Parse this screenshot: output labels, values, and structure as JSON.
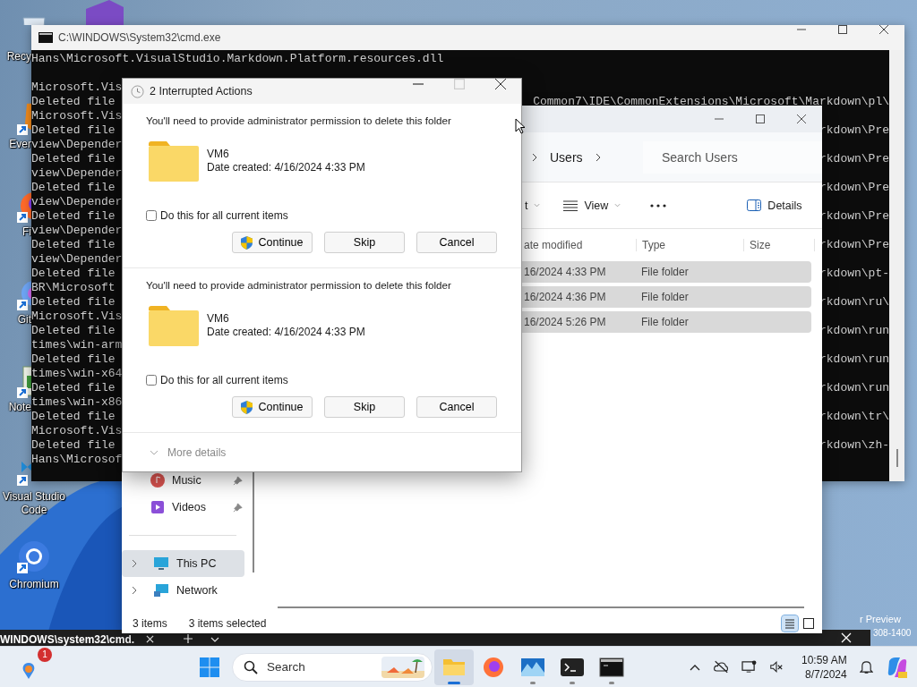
{
  "desktop": {
    "icons": [
      {
        "label": "Recy",
        "kind": "recycle-bin",
        "shortcut": false
      },
      {
        "label": "Ever",
        "kind": "evernote",
        "shortcut": true
      },
      {
        "label": "Fi",
        "kind": "firefox",
        "shortcut": true
      },
      {
        "label": "Git",
        "kind": "github",
        "shortcut": true
      },
      {
        "label": "Note",
        "kind": "notepad",
        "shortcut": true
      },
      {
        "label": "Visual Studio Code",
        "kind": "vscode",
        "shortcut": true
      },
      {
        "label": "Chromium",
        "kind": "chromium",
        "shortcut": true
      }
    ],
    "build_info": [
      "r Preview",
      "308-1400"
    ]
  },
  "cmd_window": {
    "title": "C:\\WINDOWS\\System32\\cmd.exe",
    "first_line": "Hans\\Microsoft.VisualStudio.Markdown.Platform.resources.dll",
    "lines": [
      {
        "left": "Microsoft.Vis"
      },
      {
        "left": "Deleted file",
        "right": "Common7\\IDE\\CommonExtensions\\Microsoft\\Markdown\\pl\\"
      },
      {
        "left": "Microsoft.Vis"
      },
      {
        "left": "Deleted file",
        "right": "rkdown\\Pre"
      },
      {
        "left": "view\\Depender"
      },
      {
        "left": "Deleted file",
        "right": "rkdown\\Pre"
      },
      {
        "left": "view\\Depender"
      },
      {
        "left": "Deleted file",
        "right": "rkdown\\Pre"
      },
      {
        "left": "view\\Depender"
      },
      {
        "left": "Deleted file",
        "right": "rkdown\\Pre"
      },
      {
        "left": "view\\Depender"
      },
      {
        "left": "Deleted file",
        "right": "rkdown\\Pre"
      },
      {
        "left": "view\\Depender"
      },
      {
        "left": "Deleted file",
        "right": "rkdown\\pt-"
      },
      {
        "left": "BR\\Microsoft"
      },
      {
        "left": "Deleted file",
        "right": "rkdown\\ru\\"
      },
      {
        "left": "Microsoft.Vis"
      },
      {
        "left": "Deleted file",
        "right": "rkdown\\run"
      },
      {
        "left": "times\\win-arm"
      },
      {
        "left": "Deleted file",
        "right": "rkdown\\run"
      },
      {
        "left": "times\\win-x64"
      },
      {
        "left": "Deleted file",
        "right": "rkdown\\run"
      },
      {
        "left": "times\\win-x86"
      },
      {
        "left": "Deleted file",
        "right": "rkdown\\tr\\"
      },
      {
        "left": "Microsoft.Vis"
      },
      {
        "left": "Deleted file",
        "right": "rkdown\\zh-"
      },
      {
        "left": "Hans\\Microsof"
      }
    ]
  },
  "explorer": {
    "breadcrumb": [
      "Users"
    ],
    "search": {
      "placeholder": "Search Users"
    },
    "toolbar": [
      {
        "kind": "sort",
        "label": "t"
      },
      {
        "kind": "view",
        "label": "View"
      },
      {
        "kind": "more"
      },
      {
        "kind": "details",
        "label": "Details"
      }
    ],
    "columns": [
      "ate modified",
      "Type",
      "Size"
    ],
    "rows": [
      {
        "date": "16/2024 4:33 PM",
        "type": "File folder",
        "selected": true
      },
      {
        "date": "16/2024 4:36 PM",
        "type": "File folder",
        "selected": true
      },
      {
        "date": "16/2024 5:26 PM",
        "type": "File folder",
        "selected": true
      }
    ],
    "sidebar": {
      "quick_access": [
        {
          "label": "Music",
          "kind": "music",
          "pinned": true,
          "selected": false
        },
        {
          "label": "Videos",
          "kind": "videos",
          "pinned": true,
          "selected": false
        }
      ],
      "locations": [
        {
          "label": "This PC",
          "kind": "pc",
          "selected": true
        },
        {
          "label": "Network",
          "kind": "network",
          "selected": false
        }
      ]
    },
    "status": {
      "count": "3 items",
      "selection": "3 items selected"
    },
    "view_modes": [
      {
        "kind": "details",
        "selected": true
      },
      {
        "kind": "tiles",
        "selected": false
      }
    ]
  },
  "dialog": {
    "title": "2 Interrupted Actions",
    "maximize_disabled": true,
    "items": [
      {
        "message": "You'll need to provide administrator permission to delete this folder",
        "name": "VM6",
        "date": "Date created: 4/16/2024 4:33 PM",
        "apply_all": {
          "label": "Do this for all current items",
          "checked": false
        },
        "buttons": [
          {
            "label": "Continue",
            "shield": true
          },
          {
            "label": "Skip",
            "shield": false
          },
          {
            "label": "Cancel",
            "shield": false
          }
        ]
      },
      {
        "message": "You'll need to provide administrator permission to delete this folder",
        "name": "VM6",
        "date": "Date created: 4/16/2024 4:33 PM",
        "apply_all": {
          "label": "Do this for all current items",
          "checked": false
        },
        "buttons": [
          {
            "label": "Continue",
            "shield": true
          },
          {
            "label": "Skip",
            "shield": false
          },
          {
            "label": "Cancel",
            "shield": false
          }
        ]
      }
    ],
    "more_details": "More details"
  },
  "terminal_tabs": {
    "tab_title": "WINDOWS\\system32\\cmd."
  },
  "taskbar": {
    "widgets_badge": "1",
    "search": {
      "label": "Search"
    },
    "apps": [
      {
        "kind": "file-explorer",
        "running": true,
        "selected": true
      },
      {
        "kind": "firefox",
        "running": false,
        "selected": false
      },
      {
        "kind": "photos",
        "running": true,
        "selected": false
      },
      {
        "kind": "terminal",
        "running": true,
        "selected": false
      },
      {
        "kind": "cmd",
        "running": true,
        "selected": false
      }
    ],
    "clock": {
      "time": "10:59 AM",
      "date": "8/7/2024"
    }
  }
}
